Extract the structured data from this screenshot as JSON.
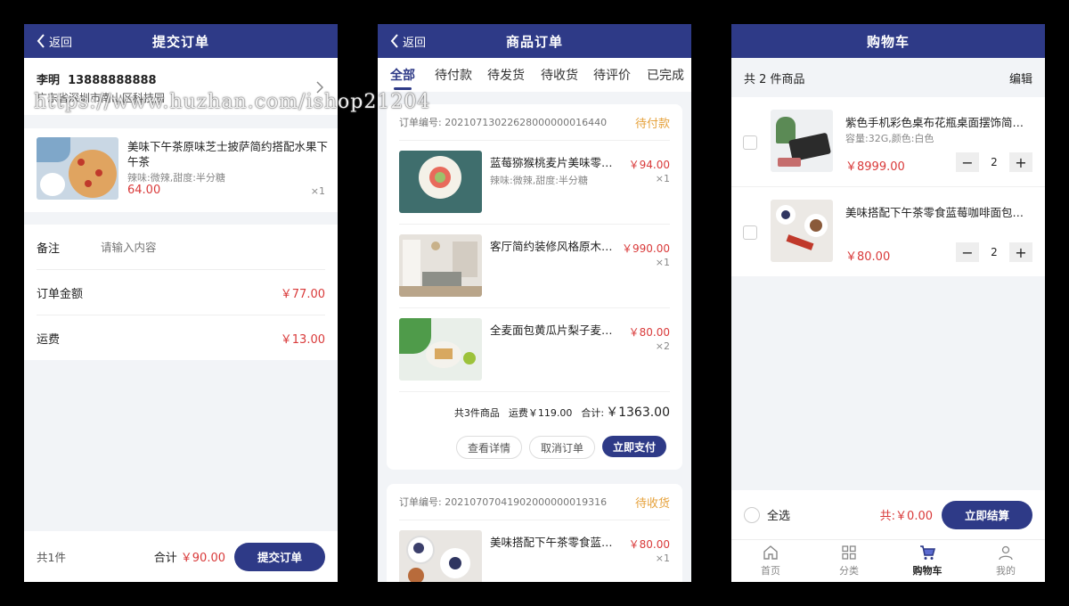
{
  "watermark": "https://www.huzhan.com/ishop21204",
  "submit_order": {
    "back": "返回",
    "title": "提交订单",
    "address": {
      "name": "李明",
      "phone": "13888888888",
      "line": "广东省深圳市南山区科技园"
    },
    "product": {
      "title": "美味下午茶原味芝士披萨简约搭配水果下午茶",
      "options": "辣味:微辣,甜度:半分糖",
      "price": "64.00",
      "qty": "×1"
    },
    "remark": {
      "label": "备注",
      "placeholder": "请输入内容"
    },
    "amount": {
      "label": "订单金额",
      "value": "￥77.00"
    },
    "shipping": {
      "label": "运费",
      "value": "￥13.00"
    },
    "footer": {
      "count": "共1件",
      "total_label": "合计",
      "total_value": "￥90.00",
      "button": "提交订单"
    }
  },
  "orders": {
    "back": "返回",
    "title": "商品订单",
    "tabs": [
      "全部",
      "待付款",
      "待发货",
      "待收货",
      "待评价",
      "已完成"
    ],
    "order1": {
      "number": "订单编号: 20210713022628000000016440",
      "status": "待付款",
      "items": [
        {
          "title": "蓝莓猕猴桃麦片美味零食早餐",
          "options": "辣味:微辣,甜度:半分糖",
          "price": "￥94.00",
          "qty": "×1"
        },
        {
          "title": "客厅简约装修风格原木家具套装",
          "options": "",
          "price": "￥990.00",
          "qty": "×1"
        },
        {
          "title": "全麦面包黄瓜片梨子麦片早餐",
          "options": "",
          "price": "￥80.00",
          "qty": "×2"
        }
      ],
      "summary_count": "共3件商品",
      "summary_shipping": "运费￥119.00",
      "summary_total_label": "合计:",
      "summary_total": "￥1363.00",
      "btn_detail": "查看详情",
      "btn_cancel": "取消订单",
      "btn_pay": "立即支付"
    },
    "order2": {
      "number": "订单编号: 20210707041902000000019316",
      "status": "待收货",
      "items": [
        {
          "title": "美味搭配下午茶零食蓝莓咖啡",
          "options": "",
          "price": "￥80.00",
          "qty": "×1"
        }
      ]
    }
  },
  "cart": {
    "title": "购物车",
    "count": "共 2 件商品",
    "edit": "编辑",
    "items": [
      {
        "title": "紫色手机彩色桌布花瓶桌面摆饰简约风格",
        "options": "容量:32G,颜色:白色",
        "price": "￥8999.00",
        "qty": "2"
      },
      {
        "title": "美味搭配下午茶零食蓝莓咖啡面包套餐",
        "options": "",
        "price": "￥80.00",
        "qty": "2"
      }
    ],
    "select_all": "全选",
    "total": "共:￥0.00",
    "checkout": "立即结算",
    "tabbar": [
      "首页",
      "分类",
      "购物车",
      "我的"
    ]
  },
  "colors": {
    "brand": "#2e3a87",
    "price": "#d93a3a",
    "status": "#e6a23c"
  }
}
